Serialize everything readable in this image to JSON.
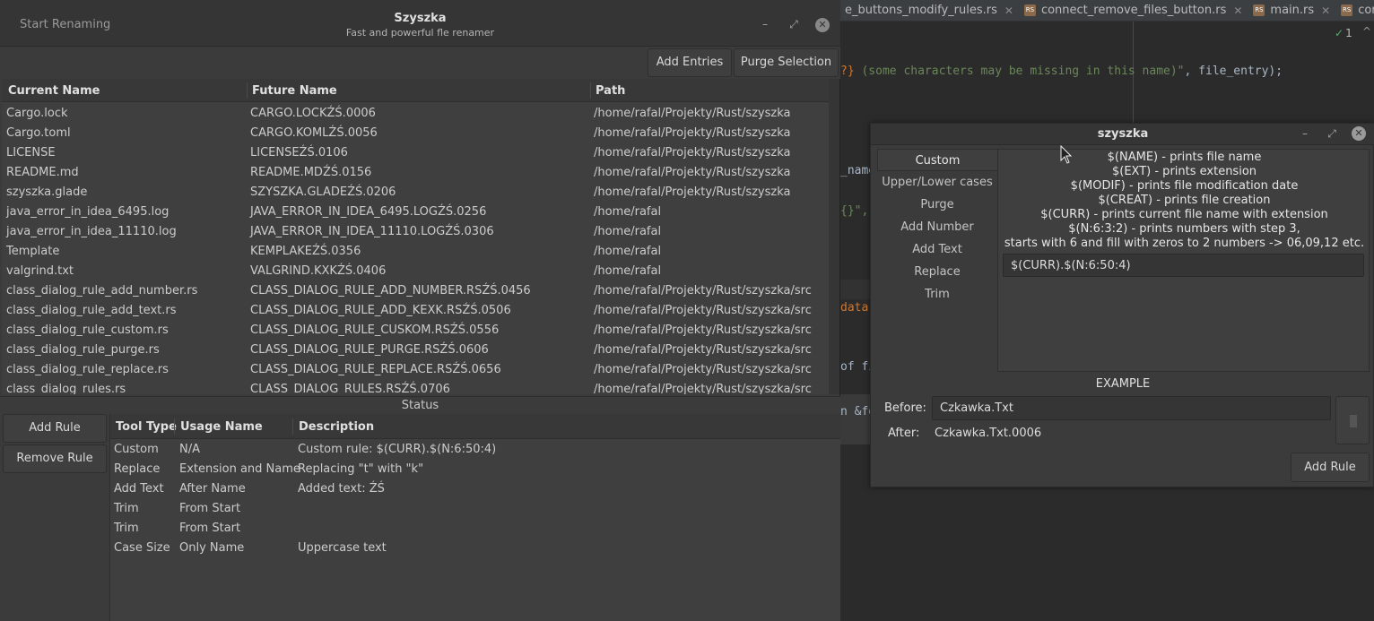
{
  "ide": {
    "tabs": [
      {
        "label": "e_buttons_modify_rules.rs",
        "icon": "rust-file-icon"
      },
      {
        "label": "connect_remove_files_button.rs",
        "icon": "rust-file-icon"
      },
      {
        "label": "main.rs",
        "icon": "rust-file-icon"
      },
      {
        "label": "connect_",
        "icon": "rust-file-icon"
      }
    ],
    "check_count": "1",
    "code_line1_brace": "?}",
    "code_line1_str": " (some characters may be missing in this name)\"",
    "code_line1_rest": ", file_entry);",
    "code_line2": "_name",
    "code_line3": "{}\",",
    "code_line4": "data",
    "code_line5": "of fi",
    "code_line6": "n &fol"
  },
  "main_window": {
    "start_renaming_label": "Start Renaming",
    "title": "Szyszka",
    "subtitle": "Fast and powerful fle renamer",
    "toolbar": {
      "add_entries_label": "Add Entries",
      "purge_selection_label": "Purge Selection"
    },
    "files": {
      "headers": [
        "Current Name",
        "Future Name",
        "Path"
      ],
      "rows": [
        [
          "Cargo.lock",
          "CARGO.LOCKŹŚ.0006",
          "/home/rafal/Projekty/Rust/szyszka"
        ],
        [
          "Cargo.toml",
          "CARGO.KOMLŹŚ.0056",
          "/home/rafal/Projekty/Rust/szyszka"
        ],
        [
          "LICENSE",
          "LICENSEŹŚ.0106",
          "/home/rafal/Projekty/Rust/szyszka"
        ],
        [
          "README.md",
          "README.MDŹŚ.0156",
          "/home/rafal/Projekty/Rust/szyszka"
        ],
        [
          "szyszka.glade",
          "SZYSZKA.GLADEŹŚ.0206",
          "/home/rafal/Projekty/Rust/szyszka"
        ],
        [
          "java_error_in_idea_6495.log",
          "JAVA_ERROR_IN_IDEA_6495.LOGŹŚ.0256",
          "/home/rafal"
        ],
        [
          "java_error_in_idea_11110.log",
          "JAVA_ERROR_IN_IDEA_11110.LOGŹŚ.0306",
          "/home/rafal"
        ],
        [
          "Template",
          "KEMPLAKEŹŚ.0356",
          "/home/rafal"
        ],
        [
          "valgrind.txt",
          "VALGRIND.KXKŹŚ.0406",
          "/home/rafal"
        ],
        [
          "class_dialog_rule_add_number.rs",
          "CLASS_DIALOG_RULE_ADD_NUMBER.RSŹŚ.0456",
          "/home/rafal/Projekty/Rust/szyszka/src"
        ],
        [
          "class_dialog_rule_add_text.rs",
          "CLASS_DIALOG_RULE_ADD_KEXK.RSŹŚ.0506",
          "/home/rafal/Projekty/Rust/szyszka/src"
        ],
        [
          "class_dialog_rule_custom.rs",
          "CLASS_DIALOG_RULE_CUSKOM.RSŹŚ.0556",
          "/home/rafal/Projekty/Rust/szyszka/src"
        ],
        [
          "class_dialog_rule_purge.rs",
          "CLASS_DIALOG_RULE_PURGE.RSŹŚ.0606",
          "/home/rafal/Projekty/Rust/szyszka/src"
        ],
        [
          "class_dialog_rule_replace.rs",
          "CLASS_DIALOG_RULE_REPLACE.RSŹŚ.0656",
          "/home/rafal/Projekty/Rust/szyszka/src"
        ],
        [
          "class_dialog_rules.rs",
          "CLASS_DIALOG_RULES.RSŹŚ.0706",
          "/home/rafal/Projekty/Rust/szyszka/src"
        ]
      ]
    },
    "status_label": "Status",
    "rule_buttons": {
      "add_rule_label": "Add Rule",
      "remove_rule_label": "Remove Rule"
    },
    "rules": {
      "headers": [
        "Tool Type",
        "Usage Name",
        "Description"
      ],
      "rows": [
        [
          "Custom",
          "N/A",
          "Custom rule: $(CURR).$(N:6:50:4)"
        ],
        [
          "Replace",
          "Extension and Name",
          "Replacing \"t\" with \"k\""
        ],
        [
          "Add Text",
          "After Name",
          "Added text: ŹŚ"
        ],
        [
          "Trim",
          "From Start",
          ""
        ],
        [
          "Trim",
          "From Start",
          ""
        ],
        [
          "Case Size",
          "Only Name",
          "Uppercase text"
        ]
      ]
    }
  },
  "dialog": {
    "title": "szyszka",
    "tabs": [
      "Custom",
      "Upper/Lower cases",
      "Purge",
      "Add Number",
      "Add Text",
      "Replace",
      "Trim"
    ],
    "active_tab": 0,
    "help_lines": [
      "$(NAME) - prints file name",
      "$(EXT) - prints extension",
      "$(MODIF) - prints file modification date",
      "$(CREAT) - prints file creation",
      "$(CURR) - prints current file name with extension",
      "$(N:6:3:2) - prints numbers with step 3,",
      "starts with 6 and fill with zeros to 2 numbers -> 06,09,12 etc."
    ],
    "custom_input_value": "$(CURR).$(N:6:50:4)",
    "example_title": "EXAMPLE",
    "before_label": "Before:",
    "before_value": "Czkawka.Txt",
    "after_label": "After:",
    "after_value": "Czkawka.Txt.0006",
    "add_rule_label": "Add Rule"
  }
}
